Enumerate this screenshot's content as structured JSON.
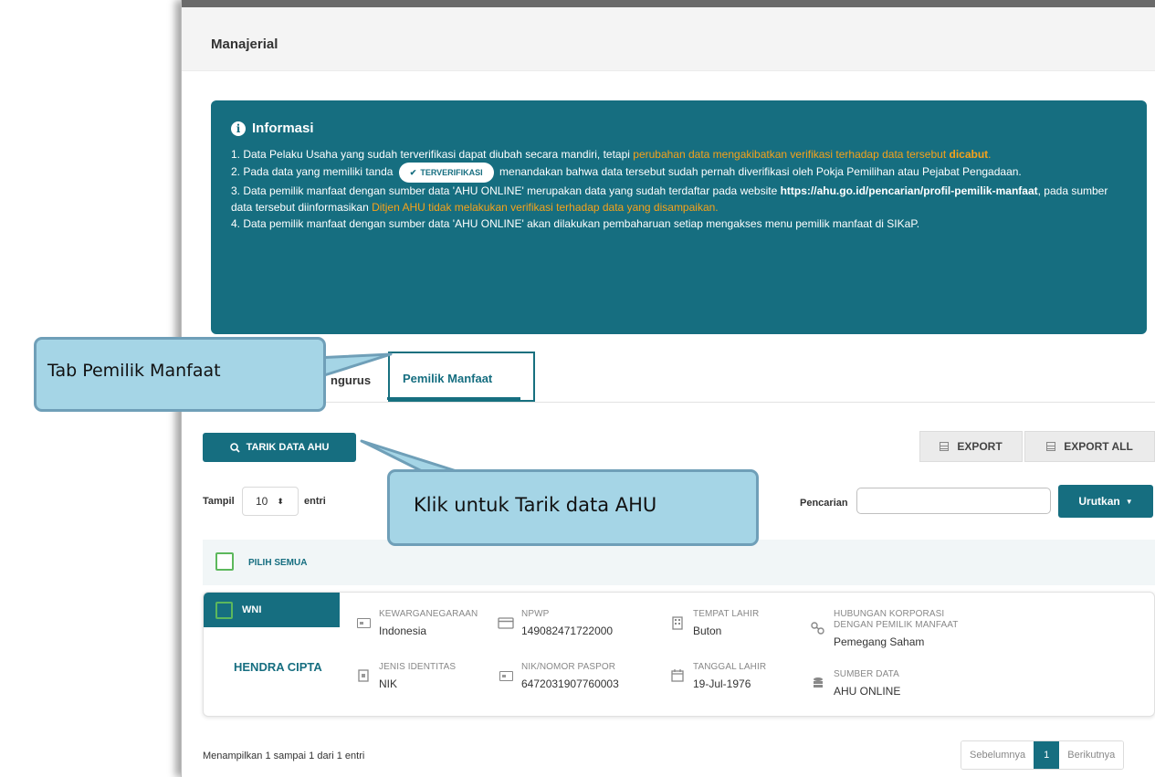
{
  "page": {
    "title": "Manajerial"
  },
  "info": {
    "heading": "Informasi",
    "items": {
      "i1_a": "1. Data Pelaku Usaha yang sudah terverifikasi dapat diubah secara mandiri, tetapi ",
      "i1_b": "perubahan data mengakibatkan verifikasi terhadap data tersebut ",
      "i1_c": "dicabut",
      "i1_d": ".",
      "i2_a": "2. Pada data yang memiliki tanda",
      "i2_pill": "TERVERIFIKASI",
      "i2_b": "menandakan bahwa data tersebut sudah pernah diverifikasi oleh Pokja Pemilihan atau Pejabat Pengadaan.",
      "i3_a": "3. Data pemilik manfaat dengan sumber data 'AHU ONLINE' merupakan data yang sudah terdaftar pada website ",
      "i3_b": "https://ahu.go.id/pencarian/profil-pemilik-manfaat",
      "i3_c": ", pada sumber data tersebut diinformasikan ",
      "i3_d": "Ditjen AHU tidak melakukan verifikasi terhadap data yang disampaikan.",
      "i4": "4. Data pemilik manfaat dengan sumber data 'AHU ONLINE' akan dilakukan pembaharuan setiap mengakses menu pemilik manfaat di SIKaP."
    }
  },
  "tabs": {
    "pengurus_fragment": "ngurus",
    "pemilik": "Pemilik Manfaat"
  },
  "toolbar": {
    "tarik": "TARIK DATA AHU",
    "export": "EXPORT",
    "export_all": "EXPORT ALL"
  },
  "controls": {
    "tampil": "Tampil",
    "per_page": "10",
    "entri": "entri",
    "pencarian": "Pencarian",
    "search_value": "",
    "urutkan": "Urutkan"
  },
  "select_all": "PILIH SEMUA",
  "record": {
    "tag": "WNI",
    "name": "HENDRA CIPTA",
    "kewarganegaraan_label": "KEWARGANEGARAAN",
    "kewarganegaraan": "Indonesia",
    "jenis_identitas_label": "JENIS IDENTITAS",
    "jenis_identitas": "NIK",
    "npwp_label": "NPWP",
    "npwp": "149082471722000",
    "nik_label": "NIK/NOMOR PASPOR",
    "nik": "6472031907760003",
    "tempat_lahir_label": "TEMPAT LAHIR",
    "tempat_lahir": "Buton",
    "tanggal_lahir_label": "TANGGAL LAHIR",
    "tanggal_lahir": "19-Jul-1976",
    "hubungan_label_1": "HUBUNGAN KORPORASI",
    "hubungan_label_2": "DENGAN PEMILIK MANFAAT",
    "hubungan": "Pemegang Saham",
    "sumber_label": "SUMBER DATA",
    "sumber": "AHU ONLINE"
  },
  "footer": {
    "info": "Menampilkan 1 sampai 1 dari 1 entri",
    "prev": "Sebelumnya",
    "page": "1",
    "next": "Berikutnya"
  },
  "callouts": {
    "tab": "Tab Pemilik Manfaat",
    "tarik": "Klik untuk Tarik data AHU"
  }
}
